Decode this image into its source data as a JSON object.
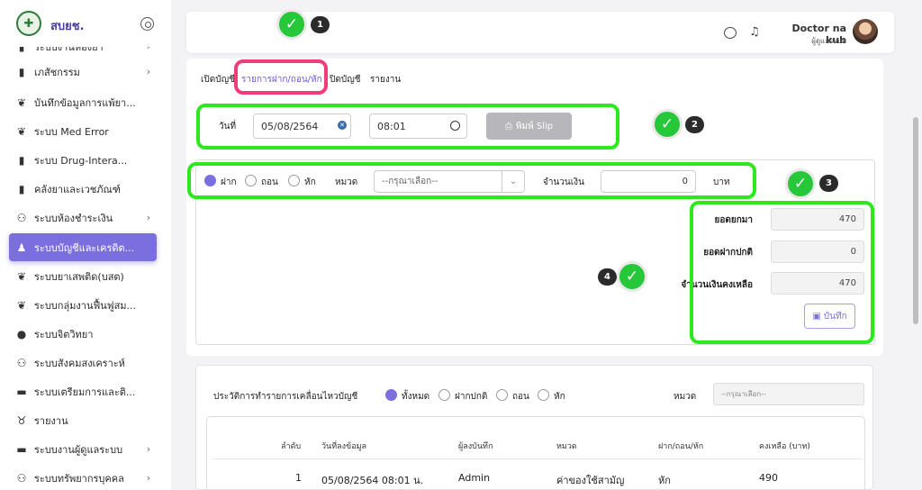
{
  "app": {
    "title": "สบยช."
  },
  "sidebar": {
    "items": [
      {
        "label": "ระบบงานห้องยา",
        "icon": "pill-icon",
        "chevron": "›"
      },
      {
        "label": "เภสัชกรรม",
        "icon": "pharmacy-icon",
        "chevron": "›"
      },
      {
        "label": "บันทึกข้อมูลการแพ้ยา...",
        "icon": "allergy-icon",
        "chevron": ""
      },
      {
        "label": "ระบบ Med Error",
        "icon": "med-error-icon",
        "chevron": ""
      },
      {
        "label": "ระบบ Drug-Intera...",
        "icon": "drug-interaction-icon",
        "chevron": ""
      },
      {
        "label": "คลังยาและเวชภัณฑ์",
        "icon": "warehouse-icon",
        "chevron": ""
      },
      {
        "label": "ระบบห้องชำระเงิน",
        "icon": "cashier-icon",
        "chevron": "›"
      },
      {
        "label": "ระบบบัญชีและเครดิต...",
        "icon": "account-icon",
        "chevron": ""
      },
      {
        "label": "ระบบยาเสพติด(บสต)",
        "icon": "narcotic-icon",
        "chevron": ""
      },
      {
        "label": "ระบบกลุ่มงานฟื้นฟูสม...",
        "icon": "rehab-icon",
        "chevron": ""
      },
      {
        "label": "ระบบจิตวิทยา",
        "icon": "psychology-icon",
        "chevron": ""
      },
      {
        "label": "ระบบสังคมสงเคราะห์",
        "icon": "social-work-icon",
        "chevron": ""
      },
      {
        "label": "ระบบเตรียมการและติ...",
        "icon": "preparation-icon",
        "chevron": ""
      },
      {
        "label": "รายงาน",
        "icon": "report-icon",
        "chevron": ""
      },
      {
        "label": "ระบบงานผู้ดูแลระบบ",
        "icon": "admin-icon",
        "chevron": "›"
      },
      {
        "label": "ระบบทรัพยากรบุคคล",
        "icon": "hr-icon",
        "chevron": "›"
      }
    ]
  },
  "header": {
    "user_name": "Doctor na kub",
    "user_role": "ผู้ดูแลระบบ",
    "chat_icon": "chat-icon",
    "bell_icon": "bell-icon"
  },
  "tabs": [
    "เปิดบัญชี",
    "รายการฝาก/ถอน/หัก",
    "ปิดบัญชี",
    "รายงาน"
  ],
  "form": {
    "date_label": "วันที่",
    "date_value": "05/08/2564",
    "time_value": "08:01",
    "print_label": "พิมพ์ Slip"
  },
  "transaction": {
    "options": [
      "ฝาก",
      "ถอน",
      "หัก"
    ],
    "selected": "ฝาก",
    "category_label": "หมวด",
    "category_placeholder": "--กรุณาเลือก--",
    "amount_label": "จำนวนเงิน",
    "amount_value": "0",
    "unit": "บาท"
  },
  "summary": {
    "carried_label": "ยอดยกมา",
    "carried_value": "470",
    "deposit_label": "ยอดฝากปกติ",
    "deposit_value": "0",
    "remaining_label": "จำนวนเงินคงเหลือ",
    "remaining_value": "470",
    "save_label": "บันทึก"
  },
  "history": {
    "title": "ประวัติการทำรายการเคลื่อนไหวบัญชี",
    "filters": [
      "ทั้งหมด",
      "ฝากปกติ",
      "ถอน",
      "หัก"
    ],
    "selected": "ทั้งหมด",
    "category_label": "หมวด",
    "category_placeholder": "--กรุณาเลือก--",
    "columns": [
      "ลำดับ",
      "วันที่ลงข้อมูล",
      "ผู้ลงบันทึก",
      "หมวด",
      "ฝาก/ถอน/หัก",
      "คงเหลือ (บาท)"
    ],
    "rows": [
      {
        "no": "1",
        "date": "05/08/2564 08:01 น.",
        "recorder": "Admin",
        "category": "ค่าของใช้สามัญ",
        "type": "หัก",
        "balance": "490"
      }
    ]
  },
  "annotations": {
    "badges": [
      "1",
      "2",
      "3",
      "4"
    ],
    "highlight_color": "#2ee81f",
    "tab_highlight_color": "#ef3d7a"
  },
  "colors": {
    "accent": "#7b6fe0",
    "brand": "#4b3f9e"
  }
}
